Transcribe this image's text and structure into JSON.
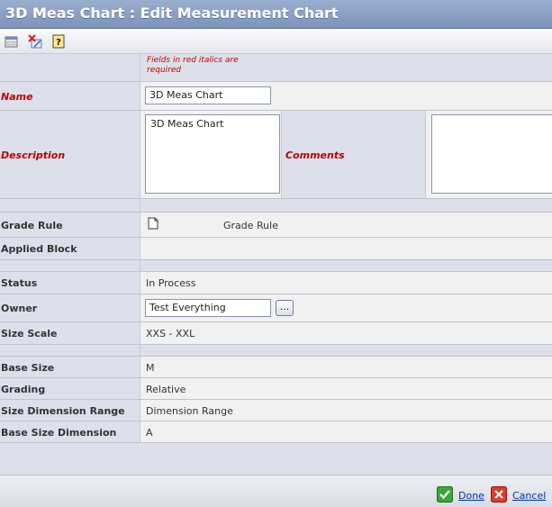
{
  "window": {
    "title": "3D Meas Chart : Edit Measurement Chart"
  },
  "toolbar": {
    "buttons": [
      {
        "icon": "url-icon",
        "name": "url-button"
      },
      {
        "icon": "clear-icon",
        "name": "clear-button"
      },
      {
        "icon": "help-icon",
        "name": "help-button"
      }
    ]
  },
  "form": {
    "required_note": "Fields in red italics are required",
    "name": {
      "label": "Name",
      "value": "3D Meas Chart"
    },
    "description": {
      "label": "Description",
      "value": "3D Meas Chart"
    },
    "comments": {
      "label": "Comments",
      "value": ""
    },
    "grade_rule": {
      "label": "Grade Rule",
      "value": "Grade Rule"
    },
    "applied_block": {
      "label": "Applied Block",
      "value": ""
    },
    "status": {
      "label": "Status",
      "value": "In Process"
    },
    "owner": {
      "label": "Owner",
      "value": "Test Everything",
      "browse_label": "..."
    },
    "size_scale": {
      "label": "Size Scale",
      "value": "XXS - XXL"
    },
    "base_size": {
      "label": "Base Size",
      "value": "M"
    },
    "grading": {
      "label": "Grading",
      "value": "Relative"
    },
    "size_dimension_range": {
      "label": "Size Dimension Range",
      "value": "Dimension Range"
    },
    "base_size_dimension": {
      "label": "Base Size Dimension",
      "value": "A"
    }
  },
  "footer": {
    "done_label": "Done",
    "cancel_label": "Cancel"
  },
  "colors": {
    "title_bar": "#8ba0c6",
    "label_bg": "#dde0ea",
    "required": "#c00000",
    "link": "#0033aa"
  }
}
